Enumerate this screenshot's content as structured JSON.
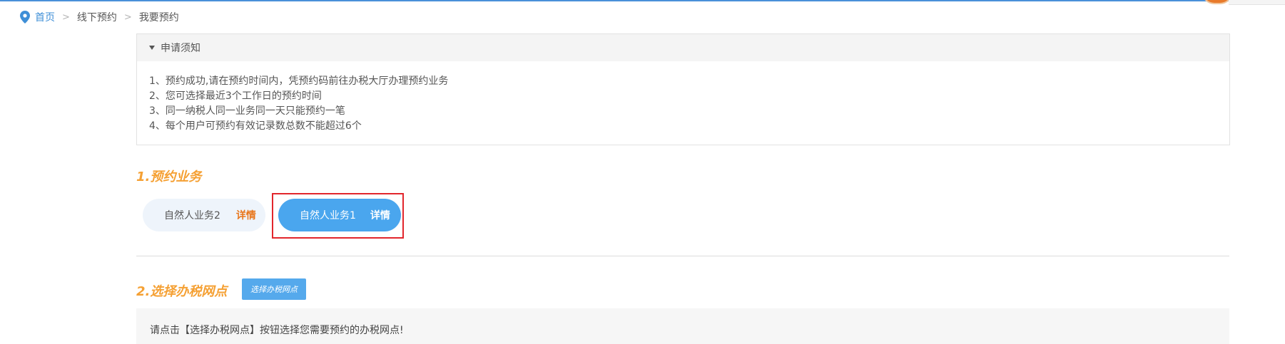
{
  "breadcrumb": {
    "home": "首页",
    "separator": ">",
    "level2": "线下预约",
    "level3": "我要预约"
  },
  "notice": {
    "title": "申请须知",
    "items": [
      "1、预约成功,请在预约时间内，凭预约码前往办税大厅办理预约业务",
      "2、您可选择最近3个工作日的预约时间",
      "3、同一纳税人同一业务同一天只能预约一笔",
      "4、每个用户可预约有效记录数总数不能超过6个"
    ]
  },
  "section1": {
    "title": "1.预约业务",
    "businesses": [
      {
        "label": "自然人业务2",
        "detail": "详情",
        "selected": false
      },
      {
        "label": "自然人业务1",
        "detail": "详情",
        "selected": true
      }
    ]
  },
  "section2": {
    "title": "2.选择办税网点",
    "button": "选择办税网点",
    "hint": "请点击【选择办税网点】按钮选择您需要预约的办税网点!"
  },
  "colors": {
    "accent_orange": "#f5a033",
    "primary_blue": "#4aa6ee",
    "detail_orange": "#e8761c",
    "highlight_red": "#e2262c",
    "link_blue": "#3f8fd7"
  },
  "icons": {
    "breadcrumb": "location-pin-icon",
    "notice_toggle": "caret-down-icon"
  }
}
